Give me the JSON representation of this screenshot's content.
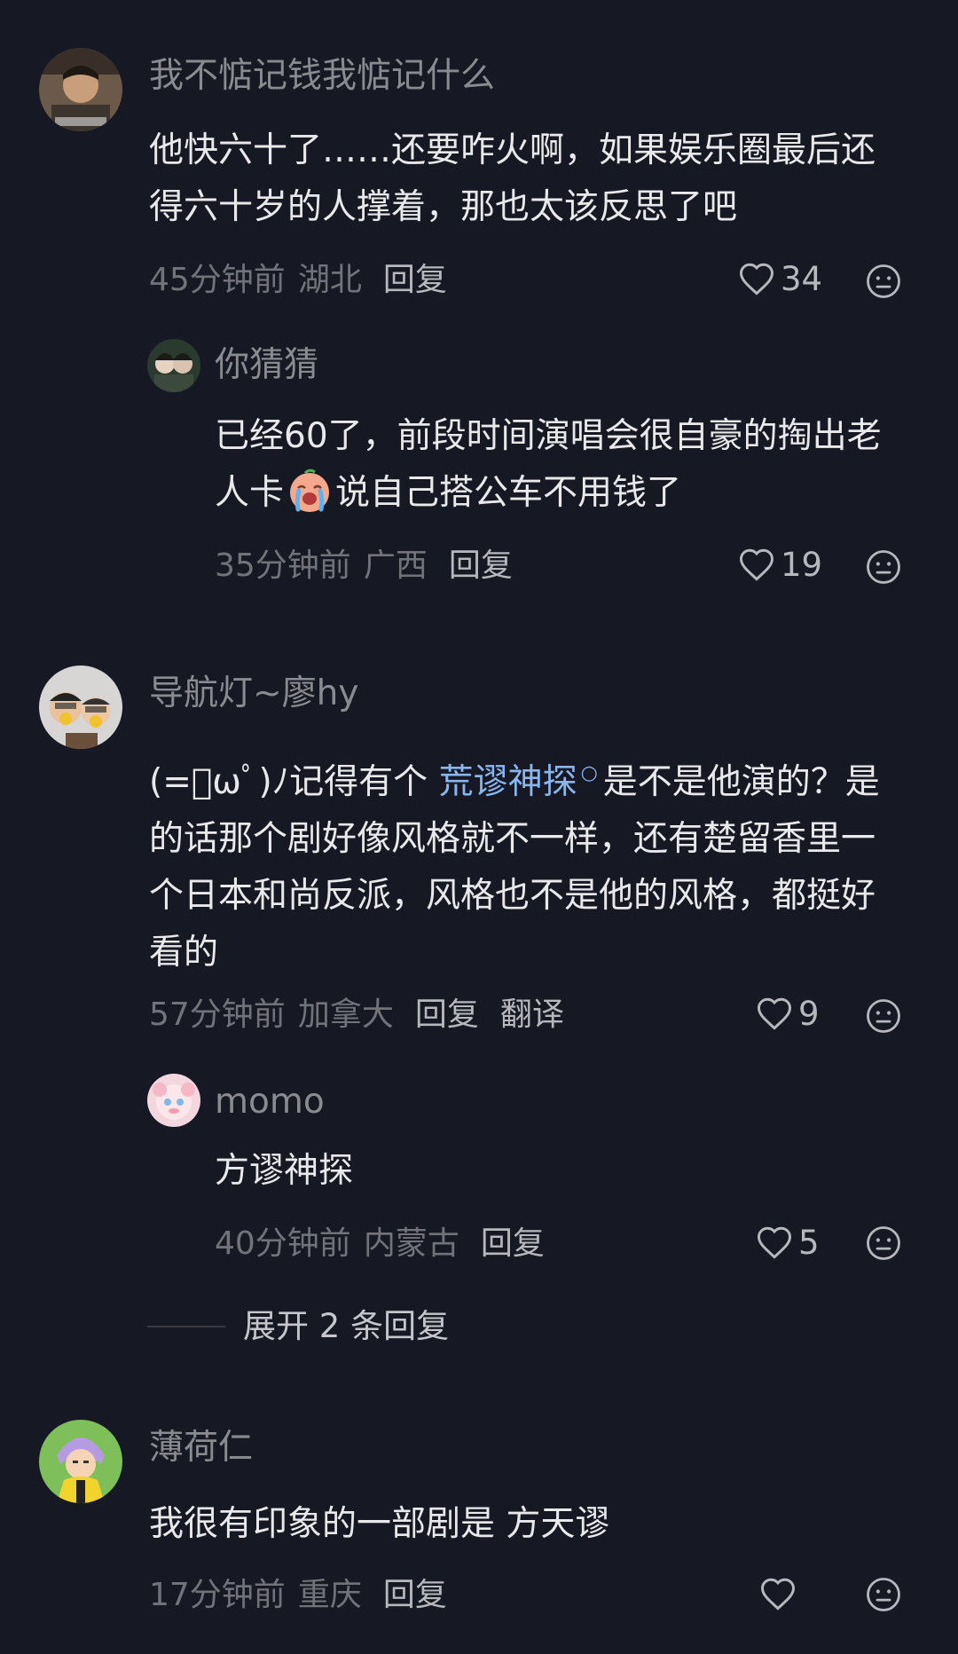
{
  "comments": [
    {
      "username": "我不惦记钱我惦记什么",
      "lines": [
        "他快六十了……还要咋火啊，如果娱乐圈最后还",
        "得六十岁的人撑着，那也太该反思了吧"
      ],
      "time": "45分钟前",
      "location": "湖北",
      "reply_label": "回复",
      "likes": "34"
    },
    {
      "username": "你猜猜",
      "lines": [
        "已经60了，前段时间演唱会很自豪的掏出老",
        "人卡",
        "说自己搭公车不用钱了"
      ],
      "time": "35分钟前",
      "location": "广西",
      "reply_label": "回复",
      "likes": "19"
    },
    {
      "username": "导航灯~廖hy",
      "prefix": "(=ﾟωﾟ)ﾉ记得有个",
      "link_text": "荒谬神探",
      "suffix": "是不是他演的？是",
      "lines": [
        "的话那个剧好像风格就不一样，还有楚留香里一",
        "个日本和尚反派，风格也不是他的风格，都挺好",
        "看的"
      ],
      "time": "57分钟前",
      "location": "加拿大",
      "reply_label": "回复",
      "translate_label": "翻译",
      "likes": "9"
    },
    {
      "username": "momo",
      "lines": [
        "方谬神探"
      ],
      "time": "40分钟前",
      "location": "内蒙古",
      "reply_label": "回复",
      "likes": "5"
    },
    {
      "username": "薄荷仁",
      "lines": [
        "我很有印象的一部剧是 方天谬"
      ],
      "time": "17分钟前",
      "location": "重庆",
      "reply_label": "回复",
      "likes": ""
    }
  ],
  "expand_replies": "展开 2 条回复",
  "icons": {
    "like": "heart-outline-icon",
    "dislike": "neutral-face-icon",
    "link": "search-link-icon",
    "inline_emoji": "crying-face-emoji"
  },
  "colors": {
    "background": "#161823",
    "text": "#e9e9ec",
    "muted": "#72737a",
    "link": "#8ab6f0"
  }
}
